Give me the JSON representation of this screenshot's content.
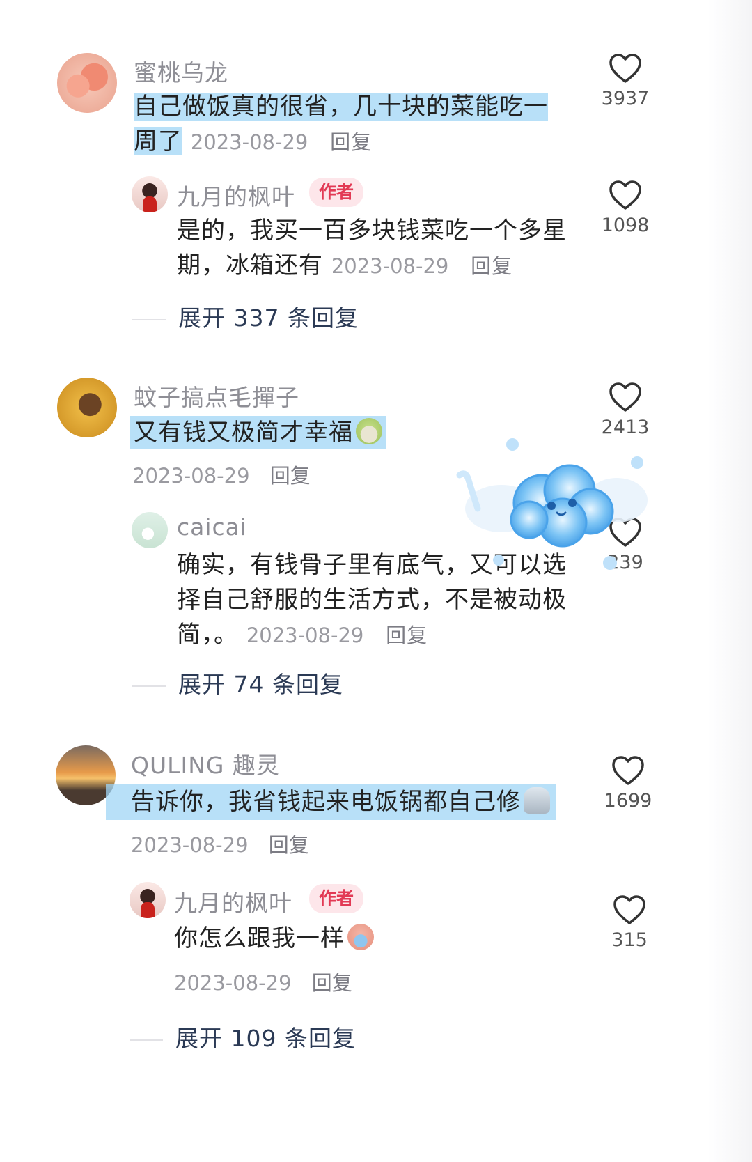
{
  "comments": [
    {
      "username": "蜜桃乌龙",
      "text": "自己做饭真的很省，几十块的菜能吃一周了",
      "text_line1": "自己做饭真的很省，几十块的菜能吃一",
      "text_line2": "周了",
      "date": "2023-08-29",
      "reply_label": "回复",
      "likes": "3937",
      "replies": [
        {
          "username": "九月的枫叶",
          "badge": "作者",
          "text_line1": "是的，我买一百多块钱菜吃一个多星",
          "text_line2": "期，冰箱还有",
          "date": "2023-08-29",
          "reply_label": "回复",
          "likes": "1098"
        }
      ],
      "expand_label": "展开 337 条回复"
    },
    {
      "username": "蚊子搞点毛撣子",
      "text": "又有钱又极简才幸福",
      "emoji": "pear-face-emoji",
      "date": "2023-08-29",
      "reply_label": "回复",
      "likes": "2413",
      "replies": [
        {
          "username": "caicai",
          "text_line1": "确实，有钱骨子里有底气，又可以选",
          "text_line2": "择自己舒服的生活方式，不是被动极",
          "text_line3": "简，。",
          "date": "2023-08-29",
          "reply_label": "回复",
          "likes": "239"
        }
      ],
      "expand_label": "展开 74 条回复"
    },
    {
      "username": "QULING 趣灵",
      "text": "告诉你，我省钱起来电饭锅都自己修",
      "emoji": "ghost-emoji",
      "date": "2023-08-29",
      "reply_label": "回复",
      "likes": "1699",
      "replies": [
        {
          "username": "九月的枫叶",
          "badge": "作者",
          "text": "你怎么跟我一样",
          "emoji": "crying-pig-emoji",
          "date": "2023-08-29",
          "reply_label": "回复",
          "likes": "315"
        }
      ],
      "expand_label": "展开 109 条回复"
    }
  ],
  "sticker": "blue-cloud-sticker",
  "colors": {
    "highlight": "#a0d6f5",
    "badge_bg": "#fde6ea",
    "badge_text": "#e23a55",
    "username": "#8e8e95",
    "expand": "#2b3a55"
  }
}
